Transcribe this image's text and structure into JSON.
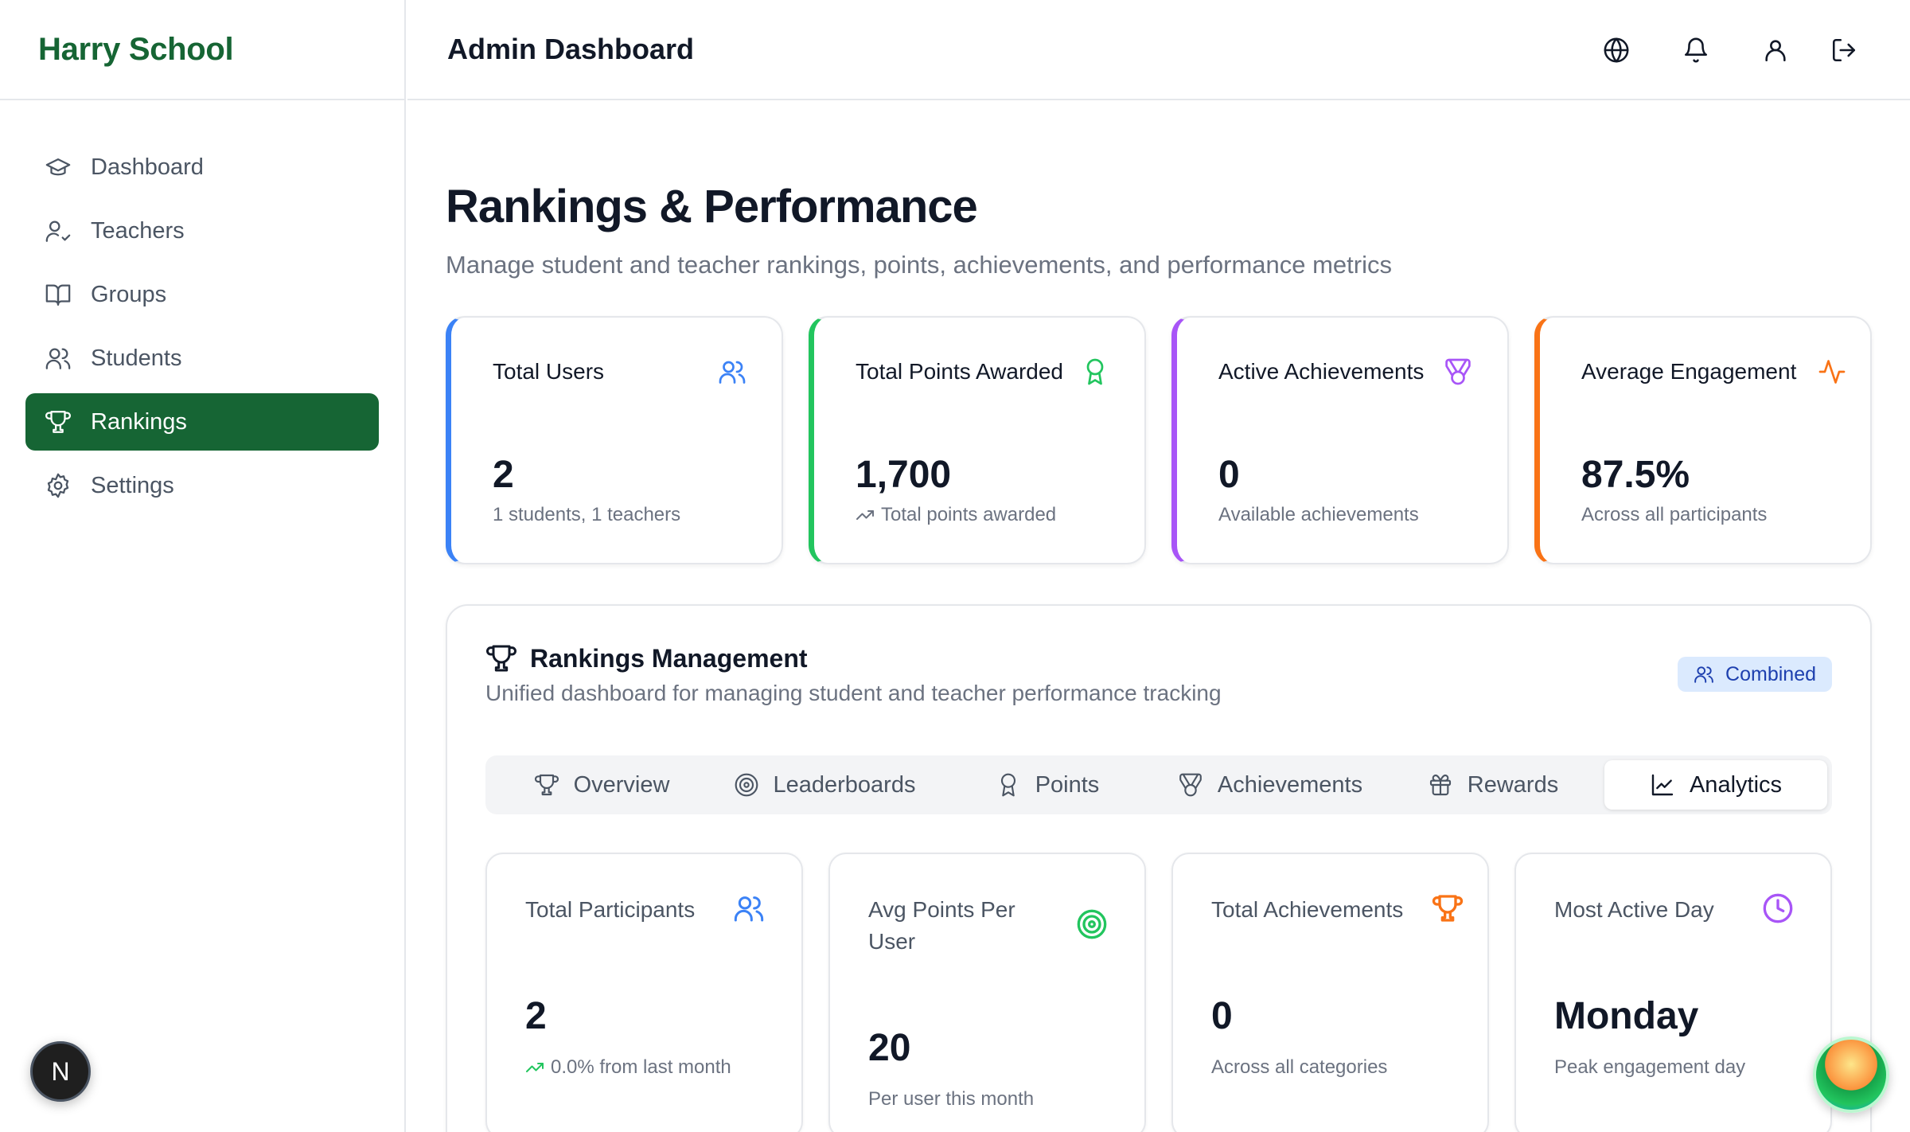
{
  "brand": "Harry School",
  "header": {
    "title": "Admin Dashboard"
  },
  "sidebar": {
    "items": [
      {
        "label": "Dashboard",
        "icon": "graduation-cap-icon"
      },
      {
        "label": "Teachers",
        "icon": "user-check-icon"
      },
      {
        "label": "Groups",
        "icon": "book-open-icon"
      },
      {
        "label": "Students",
        "icon": "users-icon"
      },
      {
        "label": "Rankings",
        "icon": "trophy-icon",
        "active": true
      },
      {
        "label": "Settings",
        "icon": "gear-icon"
      }
    ]
  },
  "dev_badge": "N",
  "page": {
    "title": "Rankings & Performance",
    "subtitle": "Manage student and teacher rankings, points, achievements, and performance metrics"
  },
  "stats": [
    {
      "label": "Total Users",
      "value": "2",
      "sub": "1 students, 1 teachers",
      "color": "#3b82f6",
      "icon": "users-icon"
    },
    {
      "label": "Total Points Awarded",
      "value": "1,700",
      "sub": "Total points awarded",
      "color": "#22c55e",
      "icon": "award-icon"
    },
    {
      "label": "Active Achievements",
      "value": "0",
      "sub": "Available achievements",
      "color": "#a855f7",
      "icon": "medal-icon"
    },
    {
      "label": "Average Engagement",
      "value": "87.5%",
      "sub": "Across all participants",
      "color": "#f97316",
      "icon": "activity-icon"
    }
  ],
  "panel": {
    "title": "Rankings Management",
    "subtitle": "Unified dashboard for managing student and teacher performance tracking",
    "badge": "Combined"
  },
  "tabs": [
    {
      "label": "Overview",
      "icon": "trophy-icon"
    },
    {
      "label": "Leaderboards",
      "icon": "target-icon"
    },
    {
      "label": "Points",
      "icon": "award-icon"
    },
    {
      "label": "Achievements",
      "icon": "medal-icon"
    },
    {
      "label": "Rewards",
      "icon": "gift-icon"
    },
    {
      "label": "Analytics",
      "icon": "line-chart-icon",
      "active": true
    }
  ],
  "metrics": [
    {
      "label": "Total Participants",
      "value": "2",
      "sub": "0.0% from last month",
      "color": "#3b82f6",
      "icon": "users-icon"
    },
    {
      "label": "Avg Points Per User",
      "value": "20",
      "sub": "Per user this month",
      "color": "#22c55e",
      "icon": "target-icon"
    },
    {
      "label": "Total Achievements",
      "value": "0",
      "sub": "Across all categories",
      "color": "#f97316",
      "icon": "trophy-icon"
    },
    {
      "label": "Most Active Day",
      "value": "Monday",
      "sub": "Peak engagement day",
      "color": "#a855f7",
      "icon": "clock-icon"
    }
  ]
}
